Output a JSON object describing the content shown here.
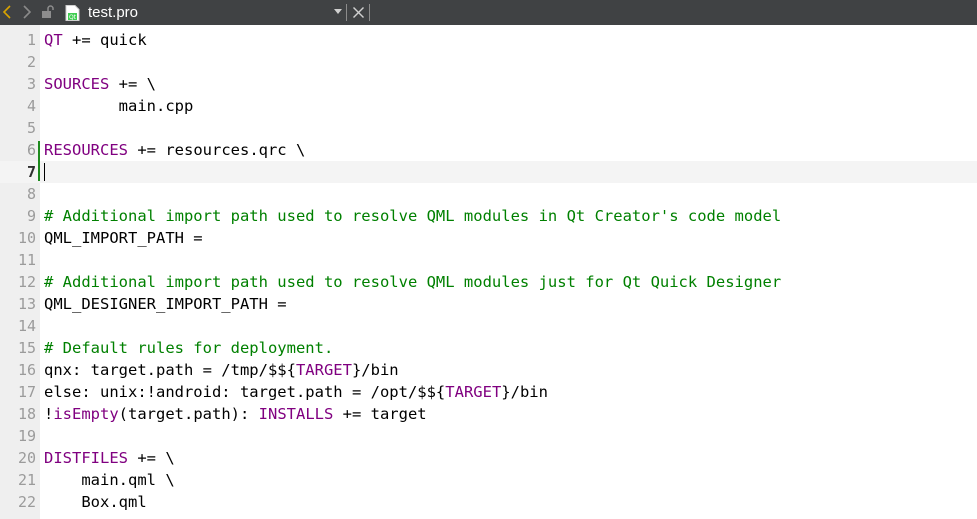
{
  "toolbar": {
    "back_icon": "chevron-left-icon",
    "forward_icon": "chevron-right-icon",
    "lock_icon": "unlock-icon",
    "file_icon": "qt-project-file-icon",
    "filename": "test.pro",
    "dropdown_icon": "triangle-down-icon",
    "close_icon": "close-icon"
  },
  "colors": {
    "tabbar_bg": "#404244",
    "gutter_bg": "#efefef",
    "variable": "#800080",
    "comment": "#008000",
    "change_marker": "#1e8a1e"
  },
  "editor": {
    "current_line": 7,
    "lines": [
      {
        "n": "1",
        "tokens": [
          {
            "t": "QT",
            "c": "var"
          },
          {
            "t": " += quick",
            "c": "plain"
          }
        ]
      },
      {
        "n": "2",
        "tokens": []
      },
      {
        "n": "3",
        "tokens": [
          {
            "t": "SOURCES",
            "c": "var"
          },
          {
            "t": " += \\",
            "c": "plain"
          }
        ]
      },
      {
        "n": "4",
        "tokens": [
          {
            "t": "        main.cpp",
            "c": "plain"
          }
        ]
      },
      {
        "n": "5",
        "tokens": []
      },
      {
        "n": "6",
        "tokens": [
          {
            "t": "RESOURCES",
            "c": "var"
          },
          {
            "t": " += resources.qrc \\",
            "c": "plain"
          }
        ]
      },
      {
        "n": "7",
        "tokens": []
      },
      {
        "n": "8",
        "tokens": []
      },
      {
        "n": "9",
        "tokens": [
          {
            "t": "# Additional import path used to resolve QML modules in Qt Creator's code model",
            "c": "comment"
          }
        ]
      },
      {
        "n": "10",
        "tokens": [
          {
            "t": "QML_IMPORT_PATH =",
            "c": "plain"
          }
        ]
      },
      {
        "n": "11",
        "tokens": []
      },
      {
        "n": "12",
        "tokens": [
          {
            "t": "# Additional import path used to resolve QML modules just for Qt Quick Designer",
            "c": "comment"
          }
        ]
      },
      {
        "n": "13",
        "tokens": [
          {
            "t": "QML_DESIGNER_IMPORT_PATH =",
            "c": "plain"
          }
        ]
      },
      {
        "n": "14",
        "tokens": []
      },
      {
        "n": "15",
        "tokens": [
          {
            "t": "# Default rules for deployment.",
            "c": "comment"
          }
        ]
      },
      {
        "n": "16",
        "tokens": [
          {
            "t": "qnx: target.path = /tmp/$${",
            "c": "plain"
          },
          {
            "t": "TARGET",
            "c": "var"
          },
          {
            "t": "}/bin",
            "c": "plain"
          }
        ]
      },
      {
        "n": "17",
        "tokens": [
          {
            "t": "else: unix:!android: target.path = /opt/$${",
            "c": "plain"
          },
          {
            "t": "TARGET",
            "c": "var"
          },
          {
            "t": "}/bin",
            "c": "plain"
          }
        ]
      },
      {
        "n": "18",
        "tokens": [
          {
            "t": "!",
            "c": "plain"
          },
          {
            "t": "isEmpty",
            "c": "var"
          },
          {
            "t": "(target.path): ",
            "c": "plain"
          },
          {
            "t": "INSTALLS",
            "c": "var"
          },
          {
            "t": " += target",
            "c": "plain"
          }
        ]
      },
      {
        "n": "19",
        "tokens": []
      },
      {
        "n": "20",
        "tokens": [
          {
            "t": "DISTFILES",
            "c": "var"
          },
          {
            "t": " += \\",
            "c": "plain"
          }
        ]
      },
      {
        "n": "21",
        "tokens": [
          {
            "t": "    main.qml \\",
            "c": "plain"
          }
        ]
      },
      {
        "n": "22",
        "tokens": [
          {
            "t": "    Box.qml",
            "c": "plain"
          }
        ]
      }
    ]
  }
}
